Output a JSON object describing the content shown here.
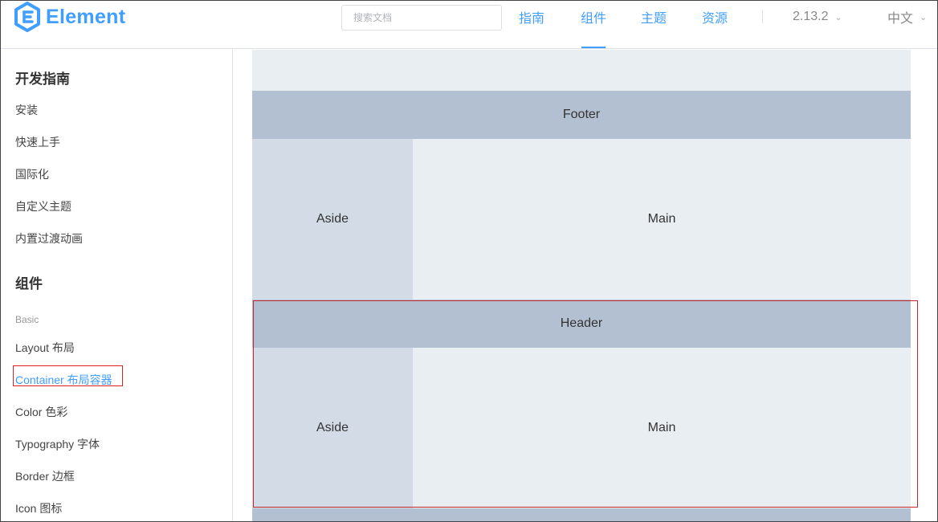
{
  "header": {
    "logo_text": "Element",
    "search_placeholder": "搜索文档",
    "nav": [
      "指南",
      "组件",
      "主题",
      "资源"
    ],
    "active_nav": "组件",
    "version": "2.13.2",
    "language": "中文",
    "brand_color": "#409eff"
  },
  "sidebar": {
    "group_guide": "开发指南",
    "guide_items": [
      "安装",
      "快速上手",
      "国际化",
      "自定义主题",
      "内置过渡动画"
    ],
    "group_components": "组件",
    "subgroup_basic": "Basic",
    "component_items": [
      "Layout 布局",
      "Container 布局容器",
      "Color 色彩",
      "Typography 字体",
      "Border 边框",
      "Icon 图标"
    ],
    "active_item": "Container 布局容器"
  },
  "demo": {
    "footer_label": "Footer",
    "aside_label_1": "Aside",
    "main_label_1": "Main",
    "header_label": "Header",
    "aside_label_2": "Aside",
    "main_label_2": "Main",
    "colors": {
      "main": "#e9eef3",
      "header": "#b3c0d1",
      "aside": "#d3dce6"
    }
  }
}
